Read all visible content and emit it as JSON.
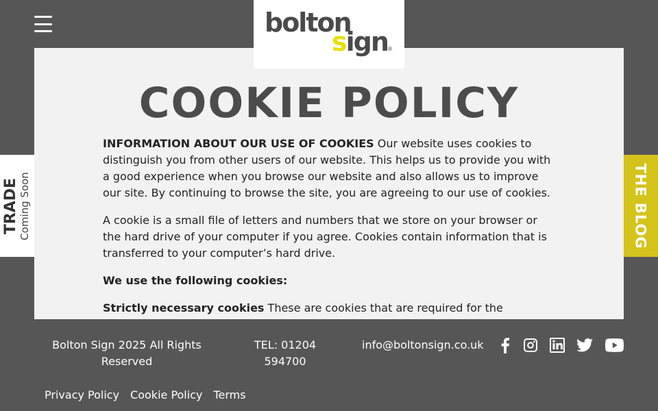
{
  "header": {
    "logo_word1": "bolton",
    "logo_word2_yellow": "s",
    "logo_word2_rest": "ign",
    "logo_registered": "®"
  },
  "page": {
    "title": "COOKIE POLICY",
    "p1_strong": "INFORMATION ABOUT OUR USE OF COOKIES",
    "p1_text": " Our website uses cookies to distinguish you from other users of our website. This helps us to provide you with a good experience when you browse our website and also allows us to improve our site. By continuing to browse the site, you are agreeing to our use of cookies.",
    "p2_text": "A cookie is a small file of letters and numbers that we store on your browser or the hard drive of your computer if you agree. Cookies contain information that is transferred to your computer’s hard drive.",
    "p3_strong": "We use the following cookies:",
    "p4_strong": "Strictly necessary cookies",
    "p4_text": " These are cookies that are required for the operation of our website. They include, for example, cookies that enable you to log into secure areas of our website."
  },
  "side_tabs": {
    "trade_title": "TRADE",
    "trade_sub": "Coming Soon",
    "blog_label": "THE BLOG"
  },
  "footer": {
    "copyright": "Bolton Sign 2025 All Rights Reserved",
    "tel": "TEL: 01204 594700",
    "email": "info@boltonsign.co.uk",
    "social_icons": [
      "facebook-icon",
      "instagram-icon",
      "linkedin-icon",
      "twitter-icon",
      "youtube-icon"
    ],
    "links": [
      "Privacy Policy",
      "Cookie Policy",
      "Terms"
    ]
  },
  "colors": {
    "background": "#575656",
    "panel": "#f2f2f2",
    "blog_tab": "#d4c31b",
    "logo_yellow": "#e6e000",
    "title": "#4c4c4c"
  }
}
